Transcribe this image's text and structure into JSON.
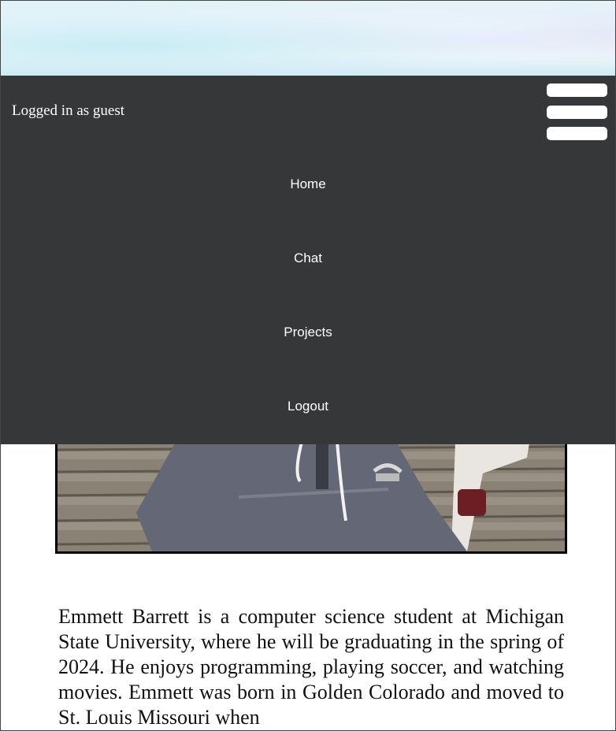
{
  "header": {
    "logged_in_text": "Logged in as guest",
    "menu_icon": "hamburger-menu-icon"
  },
  "nav": {
    "items": [
      {
        "label": "Home"
      },
      {
        "label": "Chat"
      },
      {
        "label": "Projects"
      },
      {
        "label": "Logout"
      }
    ]
  },
  "profile": {
    "photo_alt": "Photo of Emmett Barrett on stone steps",
    "bio": "Emmett Barrett is a computer science student at Michigan State University, where he will be graduating in the spring of 2024. He enjoys programming, playing soccer, and watching movies. Emmett was born in Golden Colorado and moved to St. Louis Missouri when"
  },
  "colors": {
    "nav_background": "#363738",
    "nav_text": "#ffffff",
    "page_background": "#ffffff"
  }
}
